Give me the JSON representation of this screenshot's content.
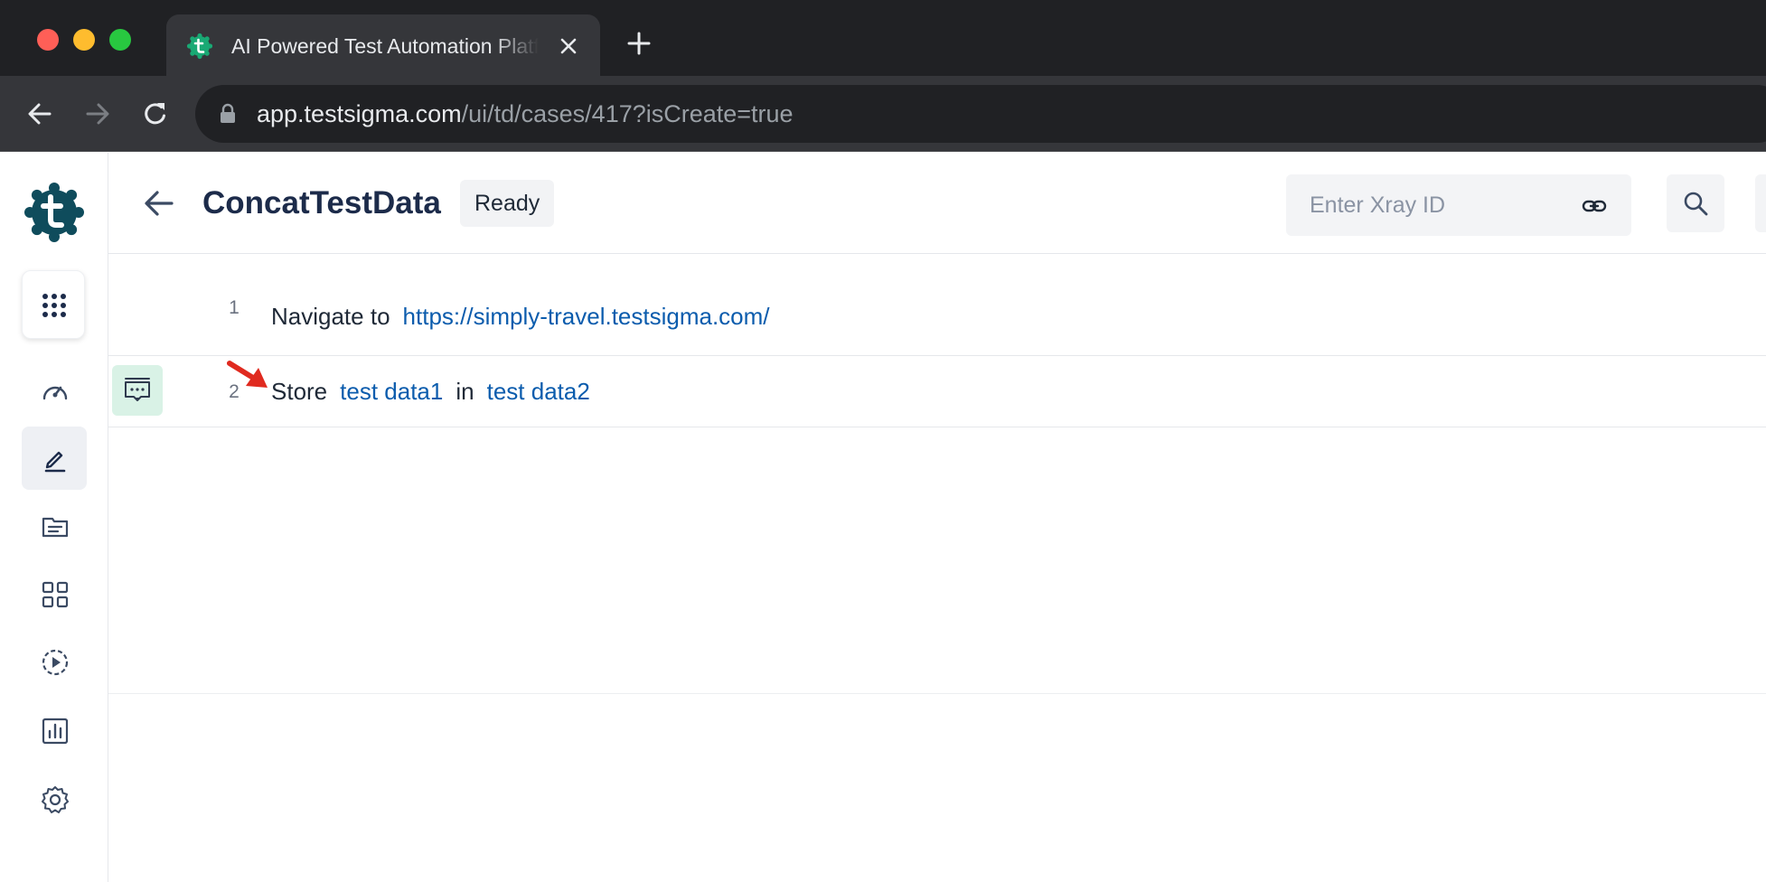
{
  "browser": {
    "tab_title": "AI Powered Test Automation Platform",
    "url_host": "app.testsigma.com",
    "url_path": "/ui/td/cases/417?isCreate=true"
  },
  "header": {
    "title": "ConcatTestData",
    "status": "Ready",
    "xray_placeholder": "Enter Xray ID"
  },
  "steps": [
    {
      "number": "1",
      "keyword": "Navigate to",
      "value": "https://simply-travel.testsigma.com/"
    },
    {
      "number": "2",
      "keyword1": "Store",
      "value1": "test data1",
      "keyword2": "in",
      "value2": "test data2"
    }
  ],
  "icons": {
    "brand": "#0f766e",
    "sidebar": [
      "apps-grid-icon",
      "dashboard-icon",
      "edit-icon",
      "document-icon",
      "grid-icon",
      "run-icon",
      "reports-icon",
      "settings-icon"
    ]
  },
  "colors": {
    "link": "#0b5cad",
    "title": "#1c2b4a",
    "annotation_arrow": "#e02a1f"
  }
}
